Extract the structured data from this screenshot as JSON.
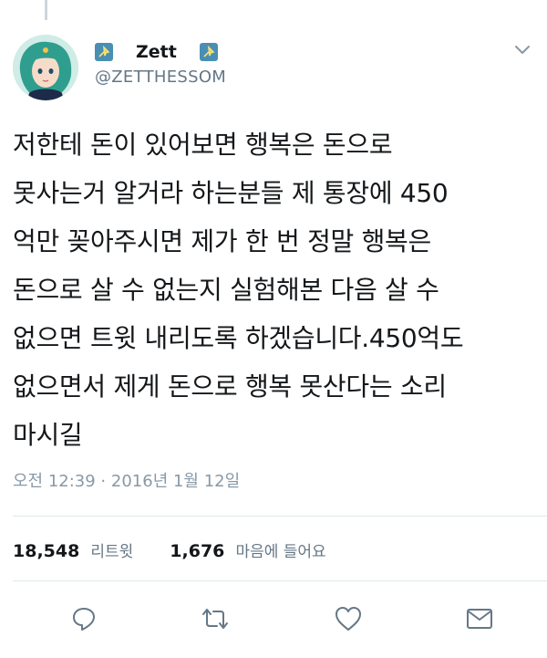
{
  "user": {
    "display_name": "Zett",
    "handle": "@ZETTHESSOM"
  },
  "tweet": {
    "text": "저한테 돈이 있어보면 행복은 돈으로\n못사는거 알거라 하는분들 제 통장에 450\n억만 꽂아주시면 제가 한 번 정말 행복은\n돈으로 살 수 없는지 실험해본 다음 살 수\n없으면 트윗 내리도록 하겠습니다.450억도\n없으면서 제게 돈으로 행복 못산다는 소리\n마시길",
    "timestamp": "오전 12:39 · 2016년 1월 12일"
  },
  "stats": {
    "retweets_count": "18,548",
    "retweets_label": "리트윗",
    "likes_count": "1,676",
    "likes_label": "마음에 들어요"
  },
  "icons": {
    "reply": "reply-icon",
    "retweet": "retweet-icon",
    "like": "heart-icon",
    "dm": "envelope-icon",
    "menu": "chevron-down-icon"
  },
  "colors": {
    "text": "#14171a",
    "secondary": "#657786",
    "icon": "#657786",
    "divider": "#e1e8ed"
  }
}
